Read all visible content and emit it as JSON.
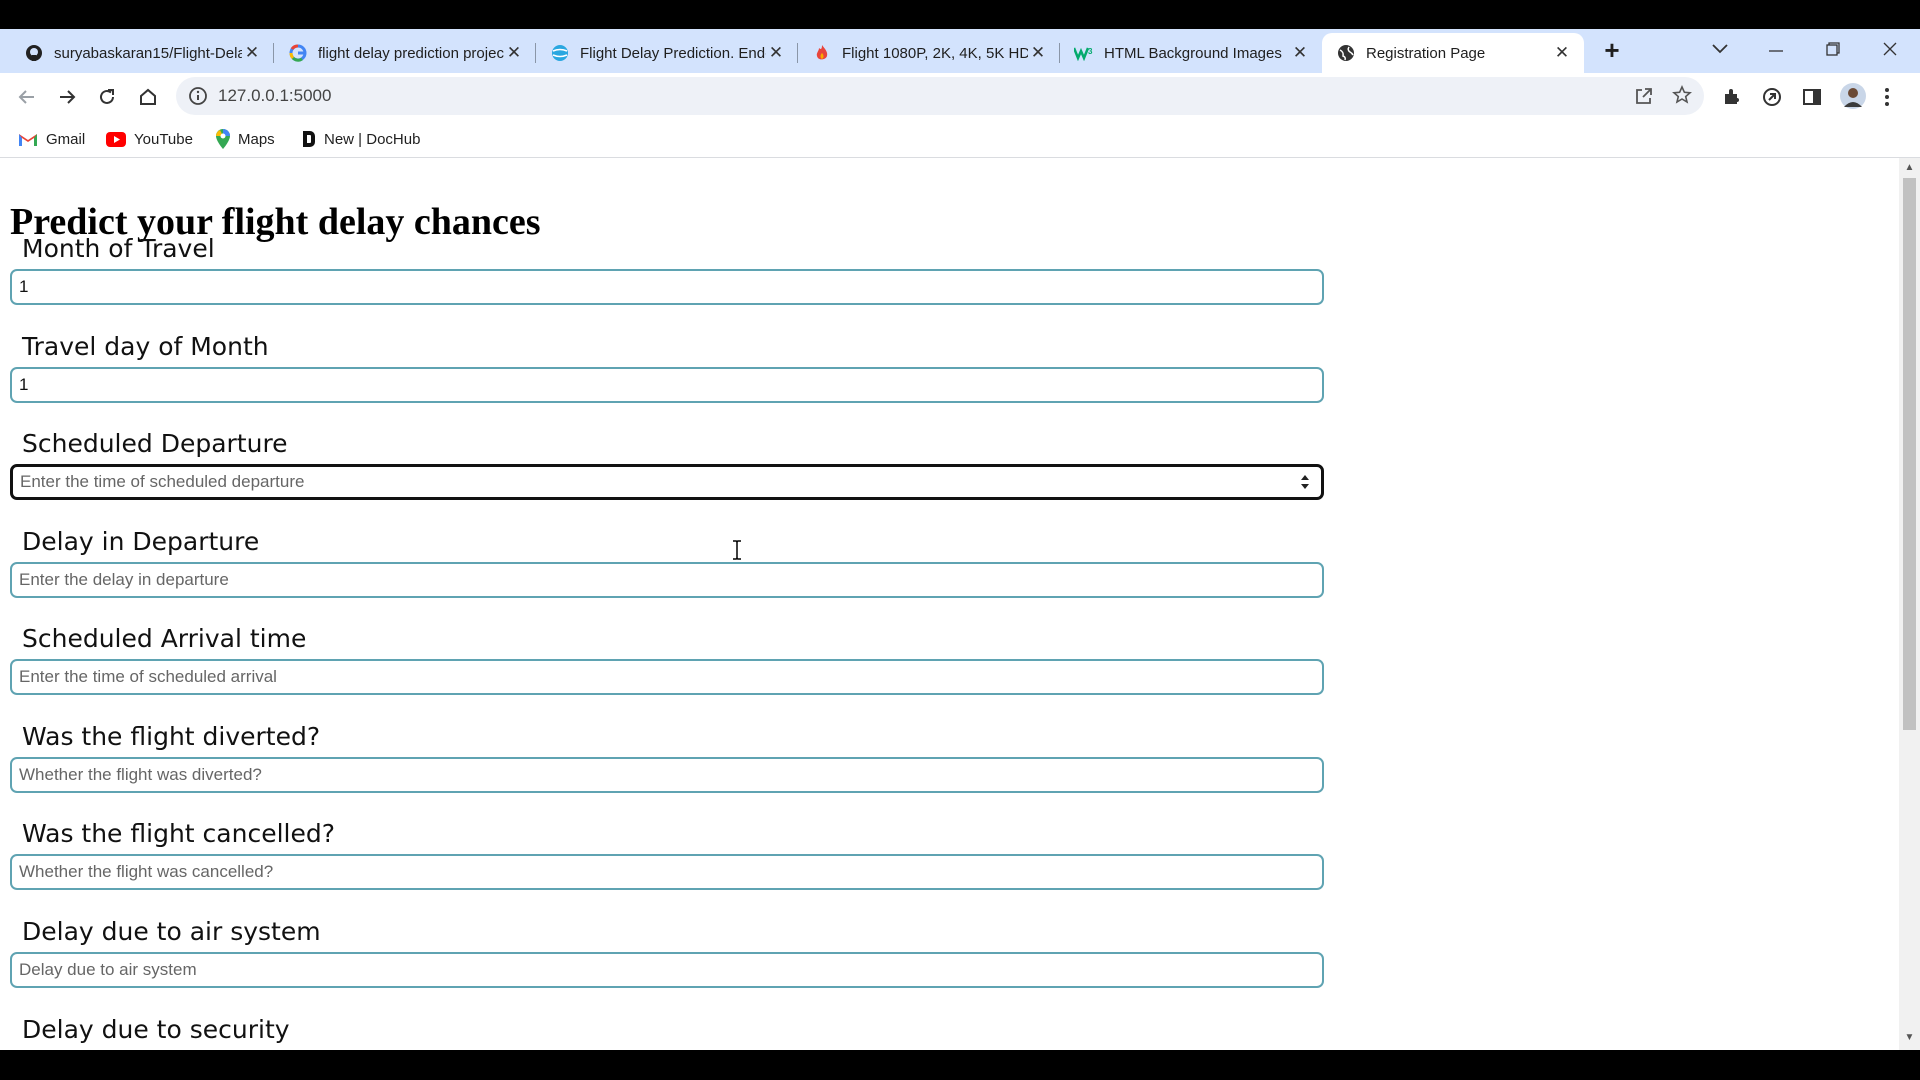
{
  "browser": {
    "tabs": [
      {
        "title": "suryabaskaran15/Flight-Delay",
        "icon": "github-icon",
        "active": false
      },
      {
        "title": "flight delay prediction project",
        "icon": "google-icon",
        "active": false
      },
      {
        "title": "Flight Delay Prediction. End-to-end",
        "icon": "globe-blue-icon",
        "active": false
      },
      {
        "title": "Flight 1080P, 2K, 4K, 5K HD",
        "icon": "fire-icon",
        "active": false
      },
      {
        "title": "HTML Background Images",
        "icon": "w3schools-icon",
        "active": false
      },
      {
        "title": "Registration Page",
        "icon": "globe-icon",
        "active": true
      }
    ],
    "url": "127.0.0.1:5000",
    "bookmarks": [
      {
        "label": "Gmail",
        "icon": "gmail-icon"
      },
      {
        "label": "YouTube",
        "icon": "youtube-icon"
      },
      {
        "label": "Maps",
        "icon": "maps-icon"
      },
      {
        "label": "New | DocHub",
        "icon": "dochub-icon"
      }
    ]
  },
  "page": {
    "title": "Predict your flight delay chances",
    "fields": [
      {
        "label": "Month of Travel",
        "value": "1",
        "placeholder": ""
      },
      {
        "label": "Travel day of Month",
        "value": "1",
        "placeholder": ""
      },
      {
        "label": "Scheduled Departure",
        "value": "",
        "placeholder": "Enter the time of scheduled departure"
      },
      {
        "label": "Delay in Departure",
        "value": "",
        "placeholder": "Enter the delay in departure"
      },
      {
        "label": "Scheduled Arrival time",
        "value": "",
        "placeholder": "Enter the time of scheduled arrival"
      },
      {
        "label": "Was the flight diverted?",
        "value": "",
        "placeholder": "Whether the flight was diverted?"
      },
      {
        "label": "Was the flight cancelled?",
        "value": "",
        "placeholder": "Whether the flight was cancelled?"
      },
      {
        "label": "Delay due to air system",
        "value": "",
        "placeholder": "Delay due to air system"
      },
      {
        "label": "Delay due to security",
        "value": "",
        "placeholder": ""
      }
    ]
  },
  "colors": {
    "tabstrip": "#d3e3fd",
    "input_border": "#5fa3b2",
    "focused_border": "#111111"
  }
}
